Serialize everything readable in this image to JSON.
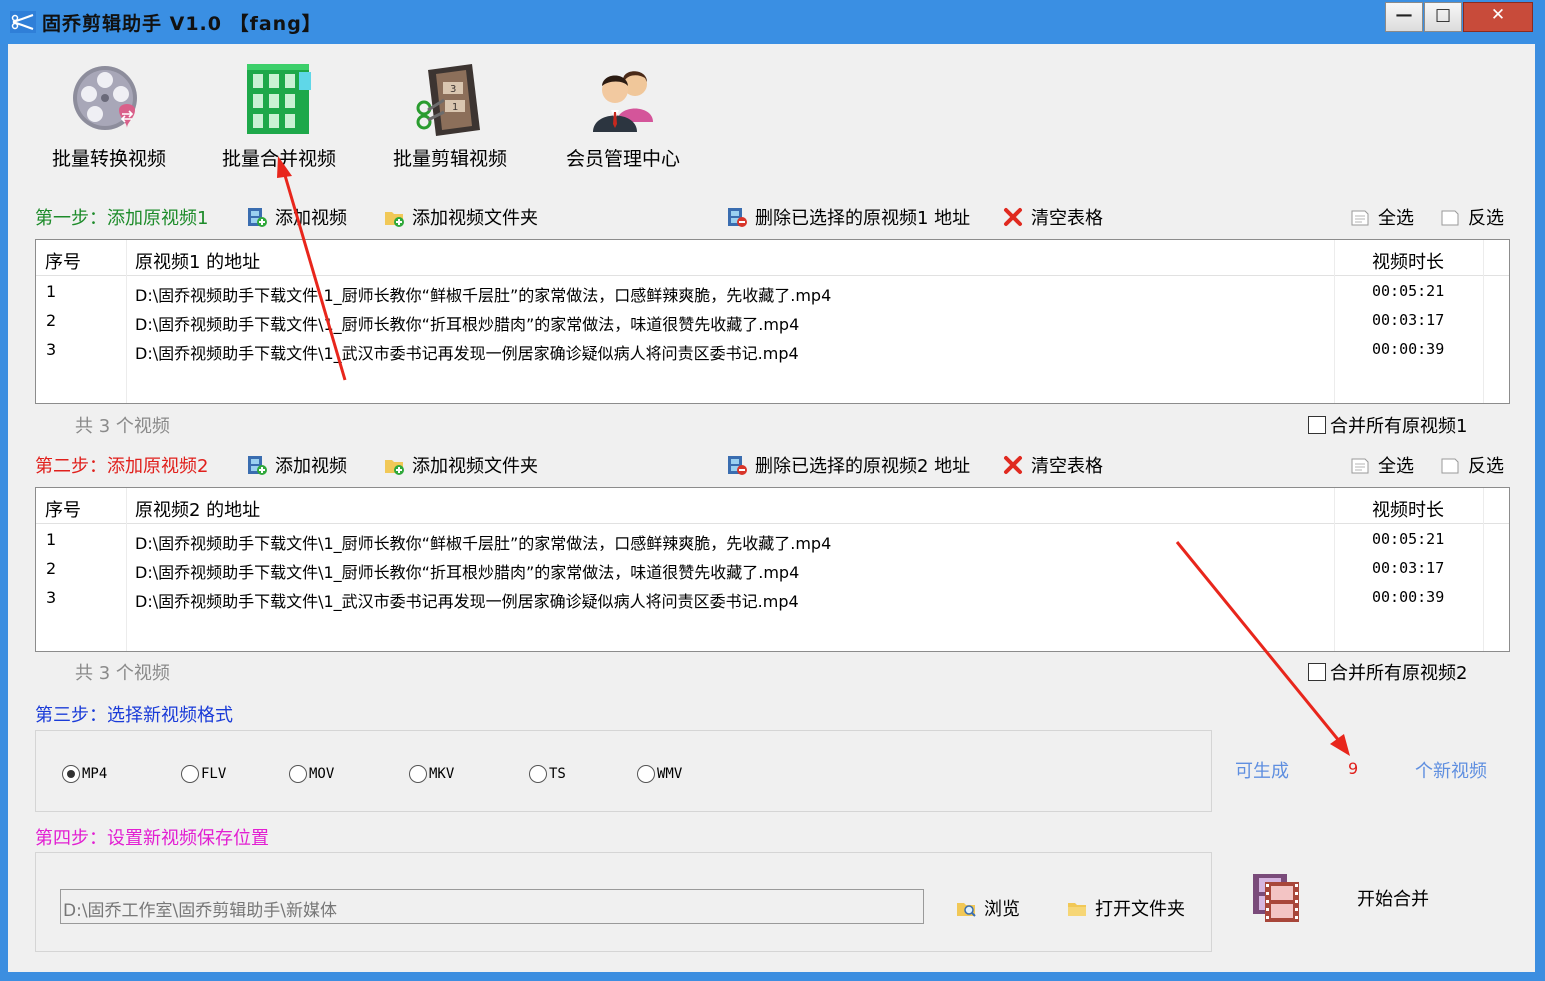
{
  "window": {
    "title": "固乔剪辑助手 V1.0 【fang】",
    "minimize": "—",
    "maximize": "□",
    "close": "✕"
  },
  "toolbar": {
    "items": [
      {
        "label": "批量转换视频",
        "icon": "film-reel-icon"
      },
      {
        "label": "批量合并视频",
        "icon": "merge-grid-icon"
      },
      {
        "label": "批量剪辑视频",
        "icon": "film-strip-icon"
      },
      {
        "label": "会员管理中心",
        "icon": "users-icon"
      }
    ]
  },
  "step1": {
    "title": "第一步：添加原视频1",
    "add_video": "添加视频",
    "add_folder": "添加视频文件夹",
    "delete_selected": "删除已选择的原视频1 地址",
    "clear_table": "清空表格",
    "select_all": "全选",
    "invert": "反选",
    "columns": {
      "index": "序号",
      "path": "原视频1 的地址",
      "duration": "视频时长"
    },
    "rows": [
      {
        "index": "1",
        "path": "D:\\固乔视频助手下载文件\\1_厨师长教你“鲜椒千层肚”的家常做法，口感鲜辣爽脆，先收藏了.mp4",
        "duration": "00:05:21"
      },
      {
        "index": "2",
        "path": "D:\\固乔视频助手下载文件\\1_厨师长教你“折耳根炒腊肉”的家常做法，味道很赞先收藏了.mp4",
        "duration": "00:03:17"
      },
      {
        "index": "3",
        "path": "D:\\固乔视频助手下载文件\\1_武汉市委书记再发现一例居家确诊疑似病人将问责区委书记.mp4",
        "duration": "00:00:39"
      }
    ],
    "count_prefix": "共",
    "count": "3",
    "count_suffix": "个视频",
    "merge_all": "合并所有原视频1"
  },
  "step2": {
    "title": "第二步：添加原视频2",
    "add_video": "添加视频",
    "add_folder": "添加视频文件夹",
    "delete_selected": "删除已选择的原视频2 地址",
    "clear_table": "清空表格",
    "select_all": "全选",
    "invert": "反选",
    "columns": {
      "index": "序号",
      "path": "原视频2 的地址",
      "duration": "视频时长"
    },
    "rows": [
      {
        "index": "1",
        "path": "D:\\固乔视频助手下载文件\\1_厨师长教你“鲜椒千层肚”的家常做法，口感鲜辣爽脆，先收藏了.mp4",
        "duration": "00:05:21"
      },
      {
        "index": "2",
        "path": "D:\\固乔视频助手下载文件\\1_厨师长教你“折耳根炒腊肉”的家常做法，味道很赞先收藏了.mp4",
        "duration": "00:03:17"
      },
      {
        "index": "3",
        "path": "D:\\固乔视频助手下载文件\\1_武汉市委书记再发现一例居家确诊疑似病人将问责区委书记.mp4",
        "duration": "00:00:39"
      }
    ],
    "count_prefix": "共",
    "count": "3",
    "count_suffix": "个视频",
    "merge_all": "合并所有原视频2"
  },
  "step3": {
    "title": "第三步：选择新视频格式",
    "formats": [
      {
        "label": "MP4",
        "checked": true
      },
      {
        "label": "FLV",
        "checked": false
      },
      {
        "label": "MOV",
        "checked": false
      },
      {
        "label": "MKV",
        "checked": false
      },
      {
        "label": "TS",
        "checked": false
      },
      {
        "label": "WMV",
        "checked": false
      }
    ],
    "can_generate": "可生成",
    "generate_count": "9",
    "new_videos": "个新视频"
  },
  "step4": {
    "title": "第四步：设置新视频保存位置",
    "path": "D:\\固乔工作室\\固乔剪辑助手\\新媒体",
    "browse": "浏览",
    "open_folder": "打开文件夹",
    "start": "开始合并"
  },
  "colors": {
    "titlebar": "#3a8fe3",
    "step1": "#1d8b2a",
    "step2": "#e0201c",
    "step3": "#1a3bd8",
    "step4": "#e21fd2",
    "annotation_arrow": "#e8261c"
  }
}
